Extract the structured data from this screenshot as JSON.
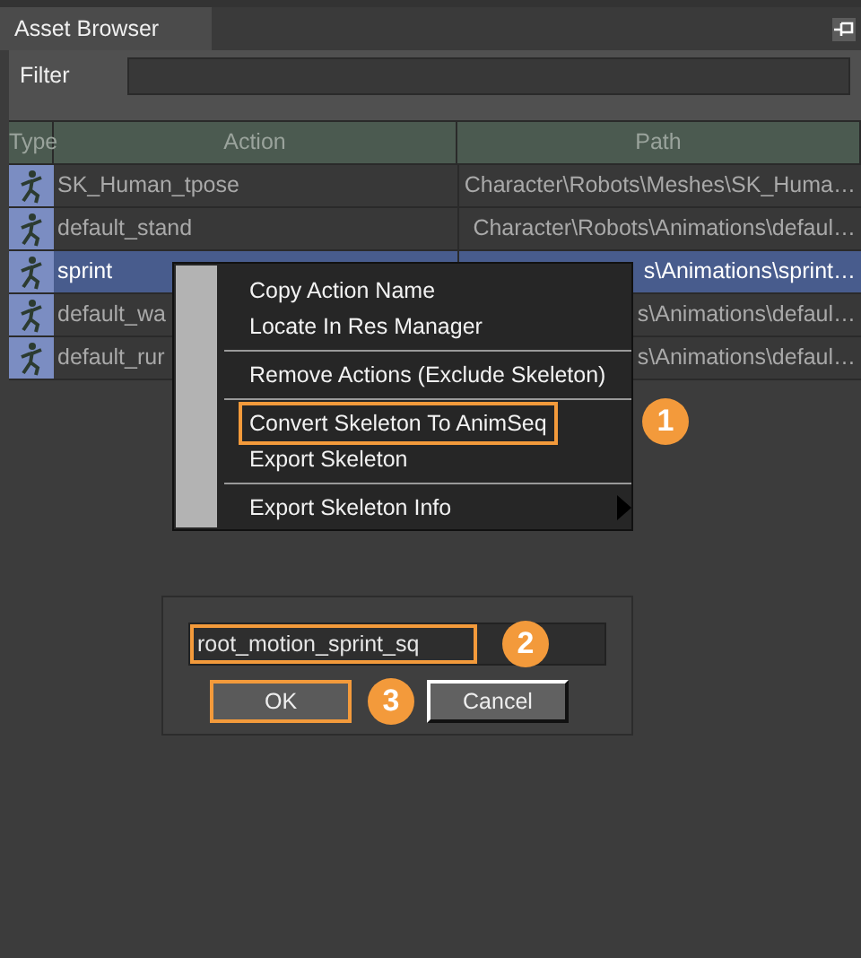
{
  "panel": {
    "title": "Asset Browser"
  },
  "filter": {
    "label": "Filter"
  },
  "table": {
    "columns": [
      "Type",
      "Action",
      "Path"
    ],
    "rows": [
      {
        "action": "SK_Human_tpose",
        "path": "Character\\Robots\\Meshes\\SK_Huma…",
        "selected": false
      },
      {
        "action": "default_stand",
        "path": "Character\\Robots\\Animations\\defaul…",
        "selected": false
      },
      {
        "action": "sprint",
        "path": "s\\Animations\\sprint…",
        "selected": true
      },
      {
        "action": "default_wa",
        "path": "s\\Animations\\defaul…",
        "selected": false
      },
      {
        "action": "default_rur",
        "path": "s\\Animations\\defaul…",
        "selected": false
      }
    ]
  },
  "context_menu": {
    "items": [
      {
        "label": "Copy Action Name",
        "kind": "item",
        "highlighted": false
      },
      {
        "label": "Locate In Res Manager",
        "kind": "item",
        "highlighted": false
      },
      {
        "kind": "separator"
      },
      {
        "label": "Remove Actions (Exclude Skeleton)",
        "kind": "item",
        "highlighted": false
      },
      {
        "kind": "separator"
      },
      {
        "label": "Convert Skeleton To AnimSeq",
        "kind": "item",
        "highlighted": true,
        "callout": "1"
      },
      {
        "label": "Export Skeleton",
        "kind": "item",
        "highlighted": false
      },
      {
        "kind": "separator"
      },
      {
        "label": "Export Skeleton Info",
        "kind": "submenu",
        "highlighted": false
      }
    ]
  },
  "dialog": {
    "input": {
      "value": "root_motion_sprint_sq",
      "highlighted": true,
      "callout": "2"
    },
    "buttons": [
      {
        "label": "OK",
        "highlighted": true,
        "callout": "3"
      },
      {
        "label": "Cancel",
        "highlighted": false
      }
    ]
  }
}
